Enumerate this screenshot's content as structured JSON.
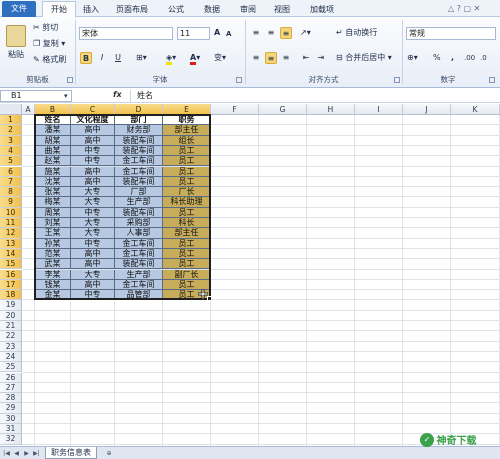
{
  "tabs": [
    "文件",
    "开始",
    "插入",
    "页面布局",
    "公式",
    "数据",
    "审阅",
    "视图",
    "加载项"
  ],
  "ribbon": {
    "clipboard": {
      "paste": "粘贴",
      "cut": "剪切",
      "copy": "复制",
      "format_painter": "格式刷",
      "label": "剪贴板"
    },
    "font": {
      "name": "宋体",
      "size": "11",
      "grow": "A",
      "shrink": "A",
      "bold": "B",
      "italic": "I",
      "underline": "U",
      "label": "字体"
    },
    "alignment": {
      "wrap": "自动换行",
      "merge": "合并后居中",
      "label": "对齐方式"
    },
    "number": {
      "format": "常规",
      "percent": "%",
      "comma": ",",
      "label": "数字"
    }
  },
  "formula_bar": {
    "name_box": "B1",
    "fx": "fx",
    "content": "姓名"
  },
  "columns": [
    "A",
    "B",
    "C",
    "D",
    "E",
    "F",
    "G",
    "H",
    "I",
    "J",
    "K"
  ],
  "rows": [
    "1",
    "2",
    "3",
    "4",
    "5",
    "6",
    "7",
    "8",
    "9",
    "10",
    "11",
    "12",
    "13",
    "14",
    "15",
    "16",
    "17",
    "18",
    "19",
    "20",
    "21",
    "22",
    "23",
    "24",
    "25",
    "26",
    "27",
    "28",
    "29",
    "30",
    "31",
    "32"
  ],
  "table": {
    "headers": [
      "姓名",
      "文化程度",
      "部门",
      "职务"
    ],
    "rows": [
      [
        "潘某",
        "高中",
        "财务部",
        "部主任"
      ],
      [
        "胡某",
        "高中",
        "装配车间",
        "组长"
      ],
      [
        "曲某",
        "中专",
        "装配车间",
        "员工"
      ],
      [
        "赵某",
        "中专",
        "金工车间",
        "员工"
      ],
      [
        "施某",
        "高中",
        "金工车间",
        "员工"
      ],
      [
        "沈某",
        "高中",
        "装配车间",
        "员工"
      ],
      [
        "张某",
        "大专",
        "厂部",
        "厂长"
      ],
      [
        "梅某",
        "大专",
        "生产部",
        "科长助理"
      ],
      [
        "周某",
        "中专",
        "装配车间",
        "员工"
      ],
      [
        "刘某",
        "大专",
        "采购部",
        "科长"
      ],
      [
        "王某",
        "大专",
        "人事部",
        "部主任"
      ],
      [
        "孙某",
        "中专",
        "金工车间",
        "员工"
      ],
      [
        "范某",
        "高中",
        "金工车间",
        "员工"
      ],
      [
        "武某",
        "高中",
        "装配车间",
        "员工"
      ],
      [
        "李某",
        "大专",
        "生产部",
        "副厂长"
      ],
      [
        "钱某",
        "高中",
        "金工车间",
        "员工"
      ],
      [
        "金某",
        "中专",
        "品管部",
        "员工"
      ]
    ]
  },
  "sheet_tab": "职务信息表",
  "watermark": "神奇下载",
  "colors": {
    "file_tab": "#2f6fc0",
    "data_fill": "#b6c8e2",
    "job_fill": "#c7ac5a",
    "selected_header": "#f2c14e"
  }
}
